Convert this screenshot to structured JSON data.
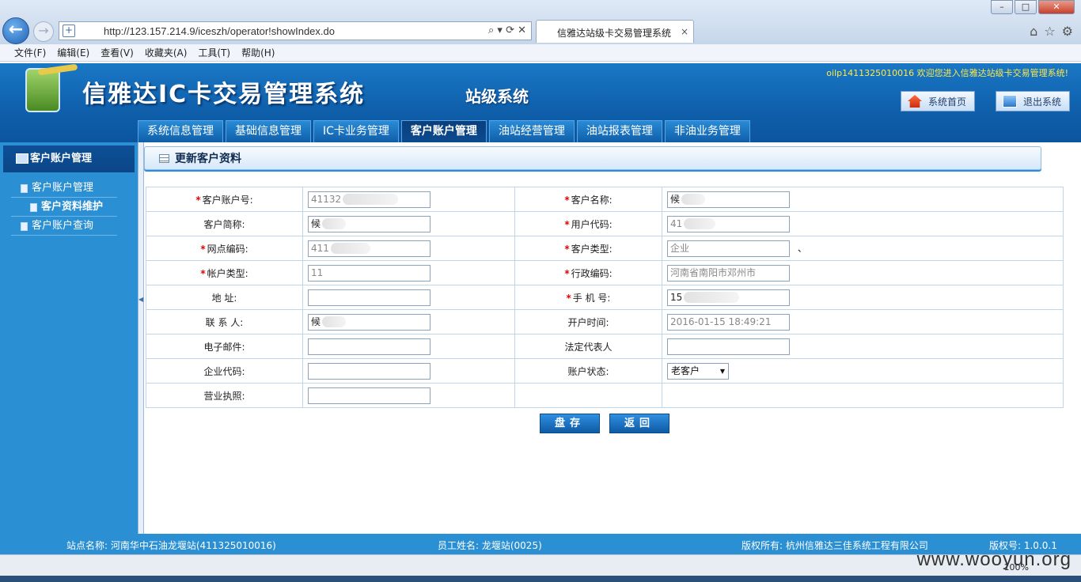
{
  "browser": {
    "url": "http://123.157.214.9/iceszh/operator!showIndex.do",
    "tab_title": "信雅达站级卡交易管理系统",
    "tab_close": "×",
    "menu": [
      "文件(F)",
      "编辑(E)",
      "查看(V)",
      "收藏夹(A)",
      "工具(T)",
      "帮助(H)"
    ],
    "zoom": "100%"
  },
  "header": {
    "title": "信雅达IC卡交易管理系统",
    "subtitle": "站级系统",
    "welcome": "oilp1411325010016 欢迎您进入信雅达站级卡交易管理系统!",
    "home_label": "系统首页",
    "exit_label": "退出系统"
  },
  "nav_tabs": [
    "系统信息管理",
    "基础信息管理",
    "IC卡业务管理",
    "客户账户管理",
    "油站经营管理",
    "油站报表管理",
    "非油业务管理"
  ],
  "sidebar": {
    "heading": "客户账户管理",
    "items": [
      {
        "label": "客户账户管理"
      },
      {
        "label": "客户资料维护"
      },
      {
        "label": "客户账户查询"
      }
    ]
  },
  "panel": {
    "title": "更新客户资料"
  },
  "form": {
    "account_no": {
      "label": "客户账户号:",
      "value": "41132"
    },
    "name": {
      "label": "客户名称:",
      "value": "候"
    },
    "short_name": {
      "label": "客户简称:",
      "value": "候"
    },
    "user_code": {
      "label": "用户代码:",
      "value": "41"
    },
    "site_code": {
      "label": "网点编码:",
      "value": "411"
    },
    "cust_type": {
      "label": "客户类型:",
      "value": "企业",
      "trailing": "、"
    },
    "acct_type": {
      "label": "帐户类型:",
      "value": "11"
    },
    "region_code": {
      "label": "行政编码:",
      "value": "河南省南阳市邓州市"
    },
    "address": {
      "label": "地 址:",
      "value": ""
    },
    "mobile": {
      "label": "手 机 号:",
      "value": "15"
    },
    "contact": {
      "label": "联 系 人:",
      "value": "候"
    },
    "open_time": {
      "label": "开户时间:",
      "value": "2016-01-15 18:49:21"
    },
    "email": {
      "label": "电子邮件:",
      "value": ""
    },
    "legal_rep": {
      "label": "法定代表人",
      "value": ""
    },
    "corp_code": {
      "label": "企业代码:",
      "value": ""
    },
    "acct_status": {
      "label": "账户状态:",
      "value": "老客户"
    },
    "license": {
      "label": "营业执照:",
      "value": ""
    }
  },
  "buttons": {
    "save": "盘存",
    "back": "返回"
  },
  "footer": {
    "station": "站点名称: 河南华中石油龙堰站(411325010016)",
    "employee": "员工姓名: 龙堰站(0025)",
    "copyright": "版权所有: 杭州信雅达三佳系统工程有限公司",
    "version": "版权号: 1.0.0.1"
  },
  "watermark": "www.wooyun.org"
}
